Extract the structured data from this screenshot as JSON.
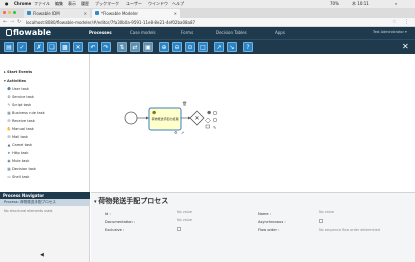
{
  "menubar": {
    "apple": "",
    "items": [
      "Chrome",
      "ファイル",
      "編集",
      "表示",
      "履歴",
      "ブックマーク",
      "ユーザー",
      "ウインドウ",
      "ヘルプ"
    ],
    "battery": "70%",
    "time": "木 10:11"
  },
  "tabs": [
    {
      "title": "Flowable IDM",
      "active": false
    },
    {
      "title": "*Flowable Modeler",
      "active": true
    }
  ],
  "address": {
    "url": "localhost:8080/flowable-modeler/#/editor/7fa30b0a-9591-11e8-8e21-4ef02ba08a87"
  },
  "app": {
    "logo": "flowable",
    "nav": [
      "Processes",
      "Case models",
      "Forms",
      "Decision Tables",
      "Apps"
    ],
    "user": "Test Administrator ▾"
  },
  "toolbar": {
    "buttons": [
      "save-icon",
      "validate-icon",
      "cut-icon",
      "copy-icon",
      "paste-icon",
      "delete-icon",
      "undo-icon",
      "redo-icon",
      "align-vertical-icon",
      "align-horizontal-icon",
      "same-size-icon",
      "zoom-in-icon",
      "zoom-out-icon",
      "zoom-actual-icon",
      "zoom-fit-icon",
      "bendpoint-add-icon",
      "bendpoint-remove-icon",
      "help-icon"
    ],
    "close": "✕"
  },
  "palette": {
    "groups": [
      {
        "label": "▸ Start Events",
        "items": []
      },
      {
        "label": "▾ Activities",
        "items": [
          "User task",
          "Service task",
          "Script task",
          "Business rule task",
          "Receive task",
          "Manual task",
          "Mail task",
          "Camel task",
          "Http task",
          "Mule task",
          "Decision task",
          "Shell task"
        ]
      }
    ]
  },
  "diagram": {
    "task_label": "荷物発送手配の処理"
  },
  "navigator": {
    "title": "Process Navigator",
    "selected": "Process: 荷物発送手配プロセス",
    "empty": "No structural elements used."
  },
  "props": {
    "title": "荷物発送手配プロセス",
    "fields_left": [
      {
        "label": "Id :",
        "value": "No value"
      },
      {
        "label": "Documentation :",
        "value": "No value"
      },
      {
        "label": "Exclusive :",
        "value": ""
      }
    ],
    "fields_right": [
      {
        "label": "Name :",
        "value": "No value"
      },
      {
        "label": "Asynchronous :",
        "value": ""
      },
      {
        "label": "Flow order :",
        "value": "No sequence flow order determined"
      }
    ]
  },
  "colors": {
    "header": "#1f3a4c",
    "accent": "#2b83c4",
    "task_fill": "#ffffcc"
  }
}
